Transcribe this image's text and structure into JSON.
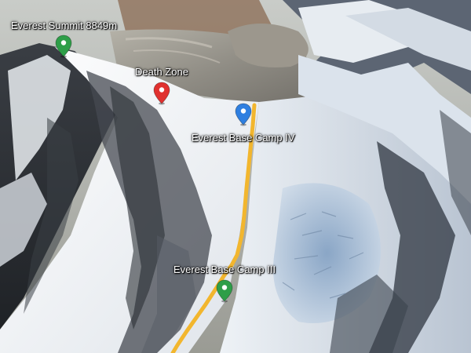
{
  "map": {
    "view": "3d-satellite-terrain",
    "route_color": "#f2b62e",
    "places": [
      {
        "name": "Everest Summit 8849m",
        "pin_color": "#2e9e48",
        "pin_icon": "map-pin-icon"
      },
      {
        "name": "Death Zone",
        "pin_color": "#e0312f",
        "pin_icon": "map-pin-icon"
      },
      {
        "name": "Everest Base Camp IV",
        "pin_color": "#2f7fe0",
        "pin_icon": "map-pin-icon"
      },
      {
        "name": "Everest Base Camp III",
        "pin_color": "#2e9e48",
        "pin_icon": "map-pin-icon"
      }
    ]
  }
}
